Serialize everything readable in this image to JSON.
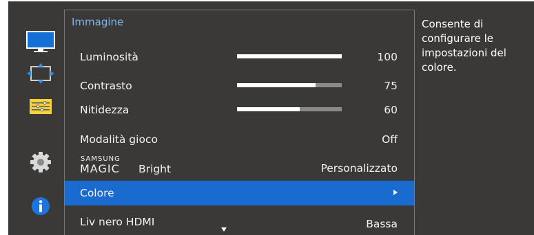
{
  "menu": {
    "title": "Immagine",
    "items": [
      {
        "label": "Luminosità",
        "value": "100",
        "level": 100
      },
      {
        "label": "Contrasto",
        "value": "75",
        "level": 75
      },
      {
        "label": "Nitidezza",
        "value": "60",
        "level": 60
      },
      {
        "label": "Modalità gioco",
        "value": "Off"
      },
      {
        "label_sup": "SAMSUNG",
        "label_main": "MAGIC",
        "label_tail": "Bright",
        "value": "Personalizzato"
      },
      {
        "label": "Colore",
        "value": "",
        "selected": true
      },
      {
        "label": "Liv nero HDMI",
        "value": "Bassa"
      }
    ]
  },
  "help": {
    "text": "Consente di configurare le impostazioni del colore."
  },
  "sidebar": {
    "icons": [
      "monitor-icon",
      "screen-size-icon",
      "settings-sliders-icon",
      "gear-icon",
      "info-icon"
    ]
  },
  "colors": {
    "accent": "#1a6bd0",
    "title": "#7fb6e8",
    "panel": "#3a3938"
  }
}
